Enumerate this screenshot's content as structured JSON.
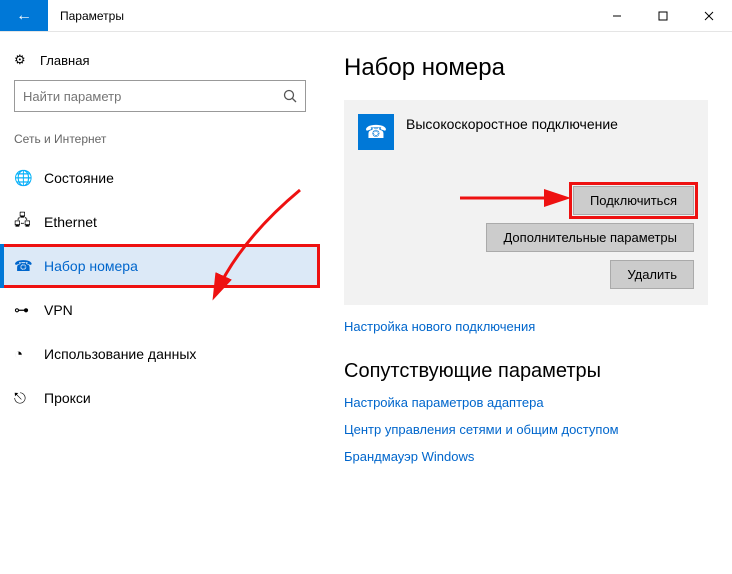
{
  "window": {
    "title": "Параметры"
  },
  "sidebar": {
    "home": "Главная",
    "search_placeholder": "Найти параметр",
    "category": "Сеть и Интернет",
    "items": [
      {
        "label": "Состояние"
      },
      {
        "label": "Ethernet"
      },
      {
        "label": "Набор номера"
      },
      {
        "label": "VPN"
      },
      {
        "label": "Использование данных"
      },
      {
        "label": "Прокси"
      }
    ]
  },
  "main": {
    "title": "Набор номера",
    "connection": {
      "name": "Высокоскоростное подключение",
      "connect": "Подключиться",
      "advanced": "Дополнительные параметры",
      "delete": "Удалить"
    },
    "new_connection_link": "Настройка нового подключения",
    "related_title": "Сопутствующие параметры",
    "related_links": {
      "adapter": "Настройка параметров адаптера",
      "sharing": "Центр управления сетями и общим доступом",
      "firewall": "Брандмауэр Windows"
    }
  }
}
